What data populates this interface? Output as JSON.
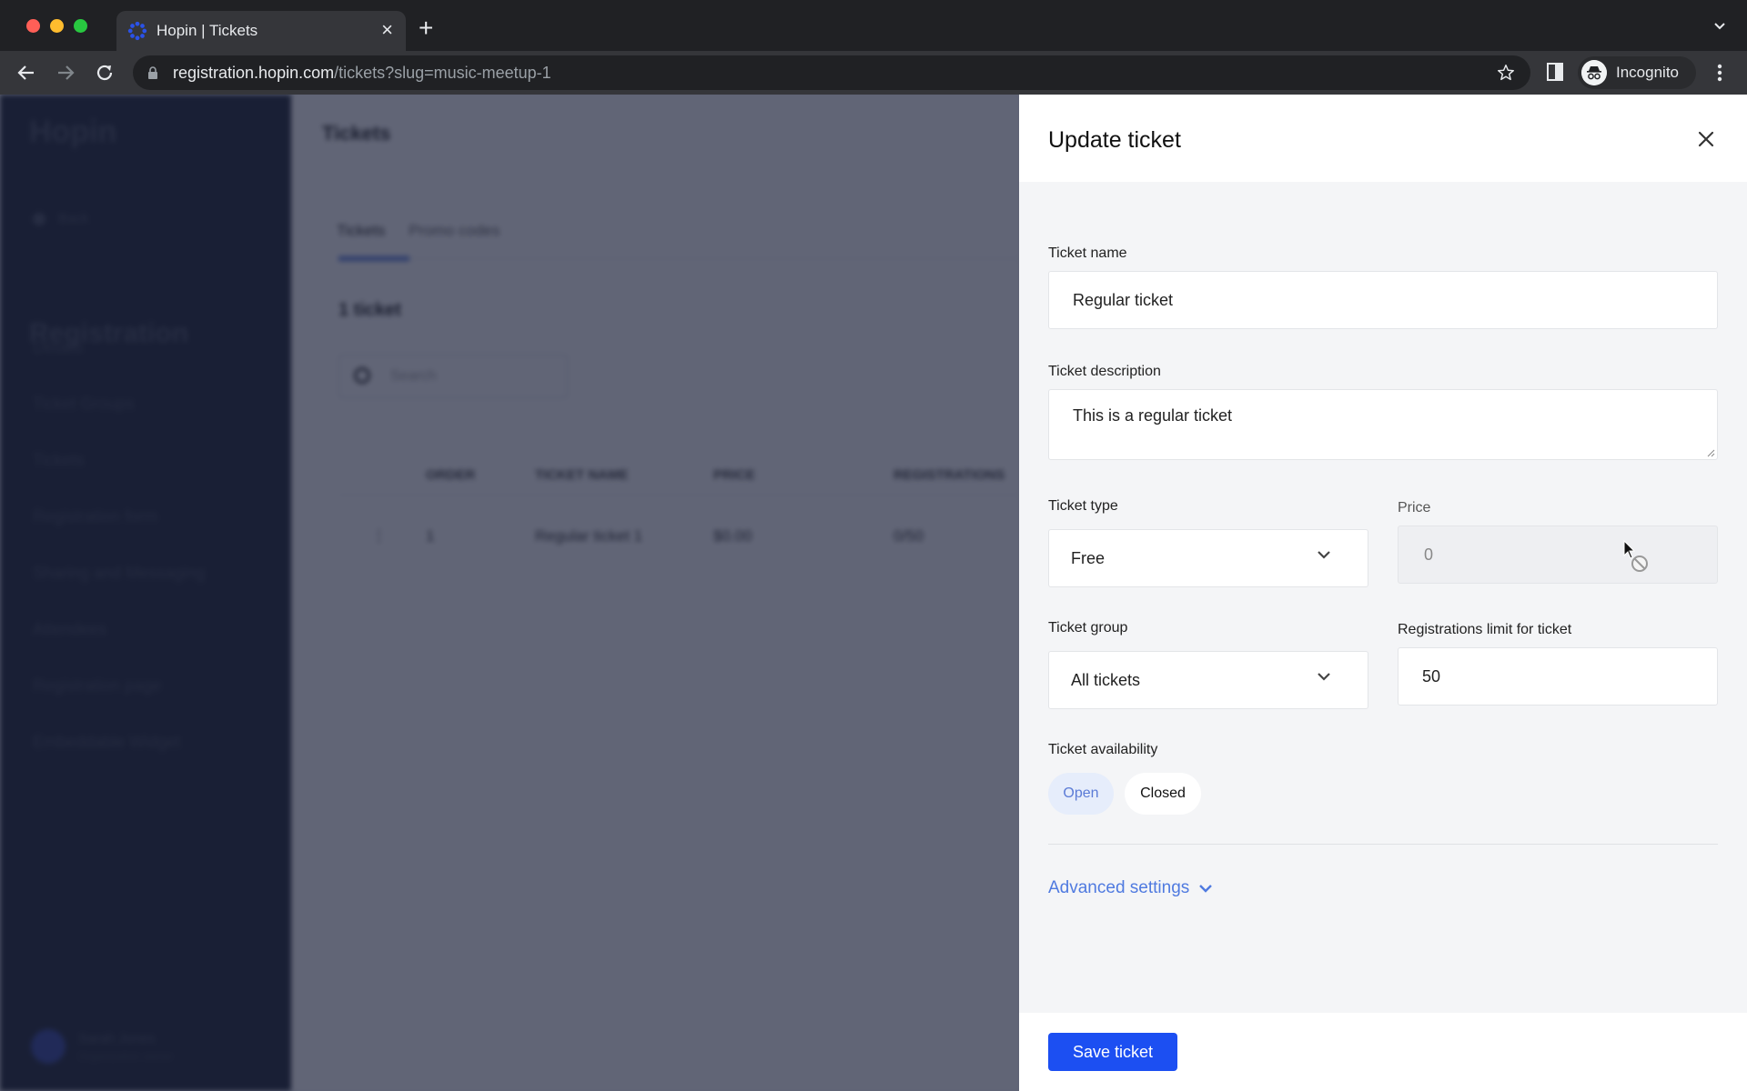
{
  "browser": {
    "tab_title": "Hopin | Tickets",
    "url_host": "registration.hopin.com",
    "url_path": "/tickets?slug=music-meetup-1",
    "profile_label": "Incognito",
    "favicon_color": "#2a52e8"
  },
  "background": {
    "sidebar": {
      "logo": "Hopin",
      "back_label": "Back",
      "heading": "Registration",
      "items": [
        "Details",
        "Ticket Groups",
        "Tickets",
        "Registration form",
        "Sharing and Messaging",
        "Attendees",
        "Registration page",
        "Embeddable Widget"
      ],
      "user_name": "Sarah Jones",
      "user_subtitle": "Organization owner"
    },
    "main": {
      "title": "Tickets",
      "tabs": [
        "Tickets",
        "Promo codes"
      ],
      "count_label": "1 ticket",
      "search_placeholder": "Search",
      "table_headers": [
        "Order",
        "Ticket name",
        "Price",
        "Registrations"
      ],
      "rows": [
        {
          "handle": "⋮",
          "order": "1",
          "name": "Regular ticket 1",
          "price": "$0.00",
          "registrations": "0/50"
        }
      ]
    }
  },
  "drawer": {
    "title": "Update ticket",
    "fields": {
      "ticket_name": {
        "label": "Ticket name",
        "value": "Regular ticket"
      },
      "ticket_description": {
        "label": "Ticket description",
        "value": "This is a regular ticket"
      },
      "ticket_type": {
        "label": "Ticket type",
        "value": "Free"
      },
      "price": {
        "label": "Price",
        "value": "0",
        "disabled": true
      },
      "ticket_group": {
        "label": "Ticket group",
        "value": "All tickets"
      },
      "registrations_limit": {
        "label": "Registrations limit for ticket",
        "value": "50"
      }
    },
    "availability": {
      "label": "Ticket availability",
      "options": [
        "Open",
        "Closed"
      ],
      "selected": "Open"
    },
    "advanced_label": "Advanced settings",
    "save_label": "Save ticket"
  },
  "colors": {
    "primary": "#1c4ff2",
    "link": "#4f7ae0",
    "sidebar_bg": "#0f1626"
  }
}
